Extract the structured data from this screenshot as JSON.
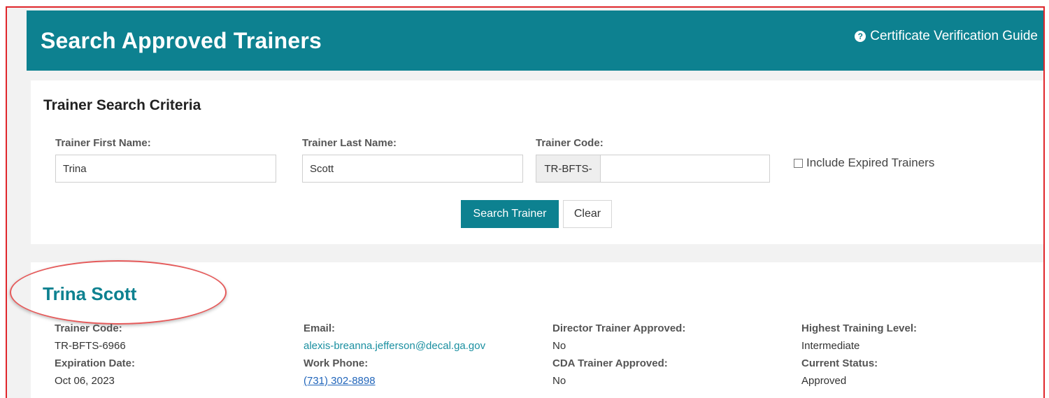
{
  "header": {
    "title": "Search Approved Trainers",
    "guide_link": "Certificate Verification Guide",
    "guide_icon": "question-circle-icon"
  },
  "search": {
    "heading": "Trainer Search Criteria",
    "first_name_label": "Trainer First Name:",
    "first_name_value": "Trina",
    "last_name_label": "Trainer Last Name:",
    "last_name_value": "Scott",
    "code_label": "Trainer Code:",
    "code_prefix": "TR-BFTS-",
    "code_value": "",
    "include_expired_label": "Include Expired Trainers",
    "search_button": "Search Trainer",
    "clear_button": "Clear"
  },
  "result": {
    "name": "Trina Scott",
    "fields": {
      "trainer_code_label": "Trainer Code:",
      "trainer_code": "TR-BFTS-6966",
      "expiration_label": "Expiration Date:",
      "expiration": "Oct 06, 2023",
      "email_label": "Email:",
      "email": "alexis-breanna.jefferson@decal.ga.gov",
      "phone_label": "Work Phone:",
      "phone": "(731) 302-8898",
      "director_label": "Director Trainer Approved:",
      "director": "No",
      "cda_label": "CDA Trainer Approved:",
      "cda": "No",
      "level_label": "Highest Training Level:",
      "level": "Intermediate",
      "status_label": "Current Status:",
      "status": "Approved"
    }
  },
  "colors": {
    "header_bg": "#0d8190",
    "accent": "#0d8190",
    "annotation": "#e0262b"
  }
}
